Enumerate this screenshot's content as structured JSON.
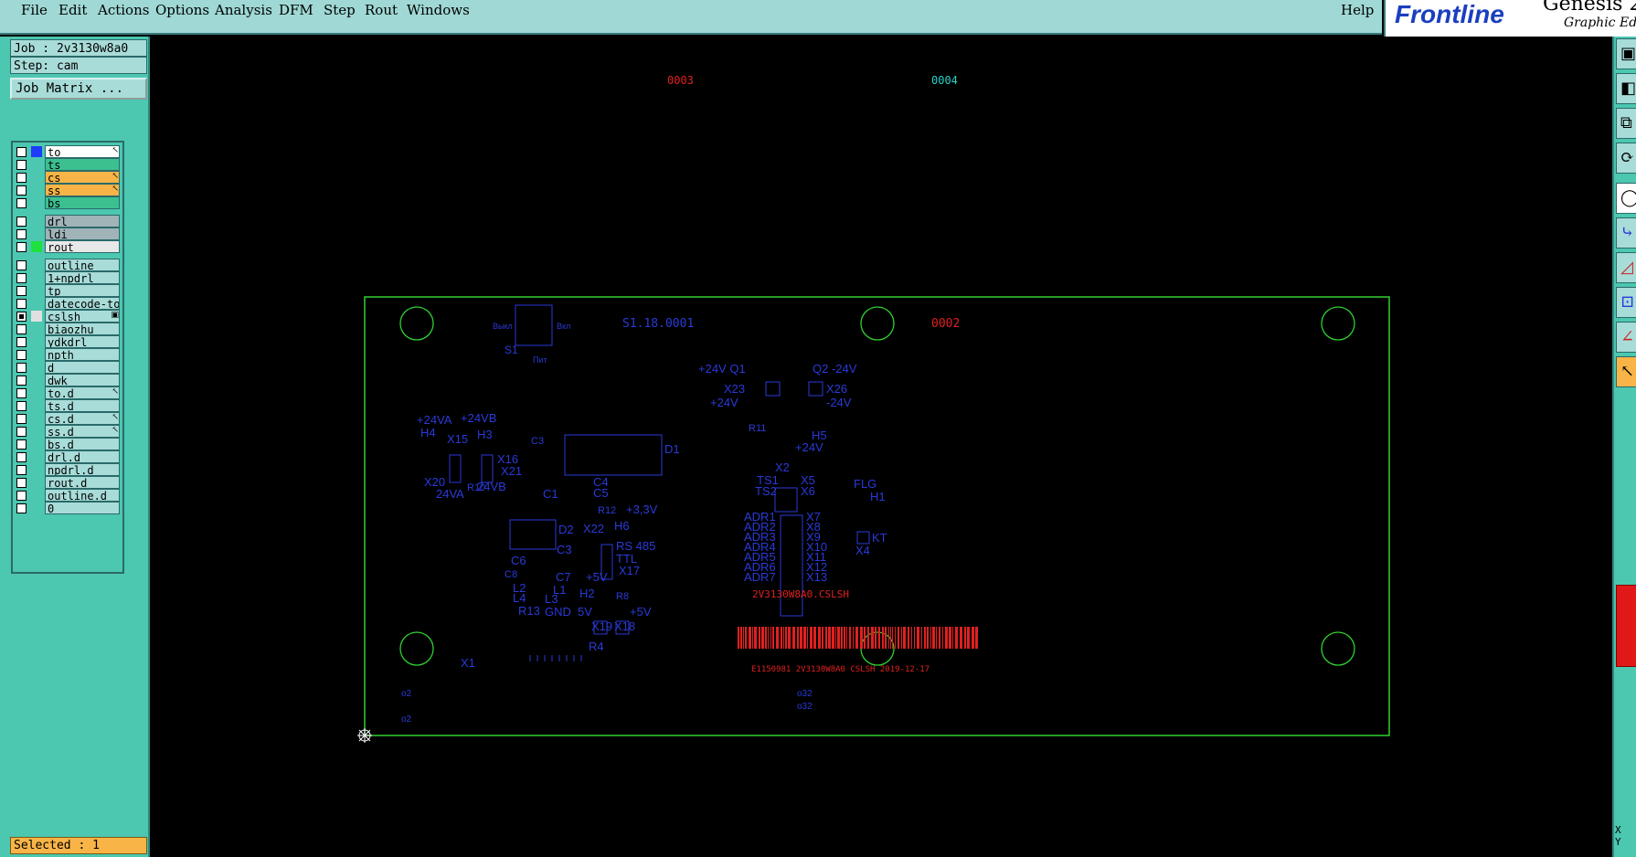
{
  "menu": [
    "File",
    "Edit",
    "Actions",
    "Options",
    "Analysis",
    "DFM",
    "Step",
    "Rout",
    "Windows"
  ],
  "help_label": "Help",
  "brand": {
    "logo": "Frontline",
    "product": "Genesis 2",
    "subtitle": "Graphic Edito"
  },
  "job": "Job : 2v3130w8a0",
  "step": "Step: cam",
  "job_matrix": "Job Matrix ...",
  "layers": [
    {
      "name": "to",
      "color": "#ffffff",
      "swatch": "#1e3cff",
      "mark": "↖",
      "checked": false
    },
    {
      "name": "ts",
      "color": "#3cc090",
      "swatch": "",
      "mark": "",
      "checked": false
    },
    {
      "name": "cs",
      "color": "#f8b446",
      "swatch": "",
      "mark": "↖",
      "checked": false
    },
    {
      "name": "ss",
      "color": "#f8b446",
      "swatch": "",
      "mark": "↖",
      "checked": false
    },
    {
      "name": "bs",
      "color": "#3cc090",
      "swatch": "",
      "mark": "",
      "checked": false
    },
    {
      "name": "drl",
      "color": "#a0b4b8",
      "swatch": "",
      "mark": "",
      "checked": false
    },
    {
      "name": "ldi",
      "color": "#a0b4b8",
      "swatch": "",
      "mark": "",
      "checked": false
    },
    {
      "name": "rout",
      "color": "#e8e8e8",
      "swatch": "#20e040",
      "mark": "",
      "checked": false
    },
    {
      "name": "outline",
      "color": "#a8dcd8",
      "swatch": "",
      "mark": "",
      "checked": false
    },
    {
      "name": "1+npdrl",
      "color": "#a8dcd8",
      "swatch": "",
      "mark": "",
      "checked": false
    },
    {
      "name": "tp",
      "color": "#a8dcd8",
      "swatch": "",
      "mark": "",
      "checked": false
    },
    {
      "name": "datecode-to",
      "color": "#a8dcd8",
      "swatch": "",
      "mark": "",
      "checked": false
    },
    {
      "name": "cslsh",
      "color": "#a8dcd8",
      "swatch": "#e0e0e0",
      "mark": "▣",
      "checked": true
    },
    {
      "name": "biaozhu",
      "color": "#a8dcd8",
      "swatch": "",
      "mark": "",
      "checked": false
    },
    {
      "name": "ydkdrl",
      "color": "#a8dcd8",
      "swatch": "",
      "mark": "",
      "checked": false
    },
    {
      "name": "npth",
      "color": "#a8dcd8",
      "swatch": "",
      "mark": "",
      "checked": false
    },
    {
      "name": "d",
      "color": "#a8dcd8",
      "swatch": "",
      "mark": "",
      "checked": false
    },
    {
      "name": "dwk",
      "color": "#a8dcd8",
      "swatch": "",
      "mark": "",
      "checked": false
    },
    {
      "name": "to.d",
      "color": "#a8dcd8",
      "swatch": "",
      "mark": "↖",
      "checked": false
    },
    {
      "name": "ts.d",
      "color": "#a8dcd8",
      "swatch": "",
      "mark": "",
      "checked": false
    },
    {
      "name": "cs.d",
      "color": "#a8dcd8",
      "swatch": "",
      "mark": "↖",
      "checked": false
    },
    {
      "name": "ss.d",
      "color": "#a8dcd8",
      "swatch": "",
      "mark": "↖",
      "checked": false
    },
    {
      "name": "bs.d",
      "color": "#a8dcd8",
      "swatch": "",
      "mark": "",
      "checked": false
    },
    {
      "name": "drl.d",
      "color": "#a8dcd8",
      "swatch": "",
      "mark": "",
      "checked": false
    },
    {
      "name": "npdrl.d",
      "color": "#a8dcd8",
      "swatch": "",
      "mark": "",
      "checked": false
    },
    {
      "name": "rout.d",
      "color": "#a8dcd8",
      "swatch": "",
      "mark": "",
      "checked": false
    },
    {
      "name": "outline.d",
      "color": "#a8dcd8",
      "swatch": "",
      "mark": "",
      "checked": false
    },
    {
      "name": "0",
      "color": "#a8dcd8",
      "swatch": "",
      "mark": "",
      "checked": false
    }
  ],
  "selected": "Selected : 1",
  "canvas_labels": {
    "marker_0003": "0003",
    "marker_0004": "0004",
    "marker_0001": "S1.18.0001",
    "marker_0002": "0002",
    "barcode_text": "2V3130W8A0.CSLSH",
    "barcode_caption": "E1150981 2V3130W8A0 CSLSH 2019-12-17",
    "x1": "X1",
    "o2a": "o2",
    "o2b": "o2",
    "o32a": "o32",
    "o32b": "o32"
  },
  "silkscreen": [
    "+24V Q1",
    "Q2 -24V",
    "X23",
    "X26",
    "+24V",
    "-24V",
    "H5",
    "+24V",
    "R11",
    "+24VA",
    "+24VB",
    "H4",
    "X15",
    "H3",
    "X16",
    "X21",
    "X20",
    "24VA",
    "R10",
    "24VB",
    "C3",
    "D1",
    "C1",
    "C4",
    "C5",
    "R12",
    "H6",
    "+3,3V",
    "D2",
    "X22",
    "RS 485",
    "TTL",
    "X17",
    "C6",
    "C3",
    "C8",
    "C7",
    "+5V",
    "L2",
    "L1",
    "L4",
    "L3",
    "H2",
    "R8",
    "R13",
    "GND",
    "5V",
    "+5V",
    "X19",
    "X18",
    "R4",
    "X2",
    "TS1",
    "TS2",
    "X5",
    "X6",
    "FLG",
    "H1",
    "KT",
    "X4",
    "ADR1",
    "ADR2",
    "ADR3",
    "ADR4",
    "ADR5",
    "ADR6",
    "ADR7",
    "X7",
    "X8",
    "X9",
    "X10",
    "X11",
    "X12",
    "X13",
    "S1",
    "Пит",
    "Выкл",
    "Вкл"
  ],
  "coord": {
    "x": "X",
    "y": "Y"
  },
  "colors": {
    "menubar": "#9fd8d4",
    "panel": "#4cc7b0",
    "outline": "#30d030",
    "silk": "#2a3ad8",
    "red": "#e02020",
    "selected": "#f8b446"
  }
}
